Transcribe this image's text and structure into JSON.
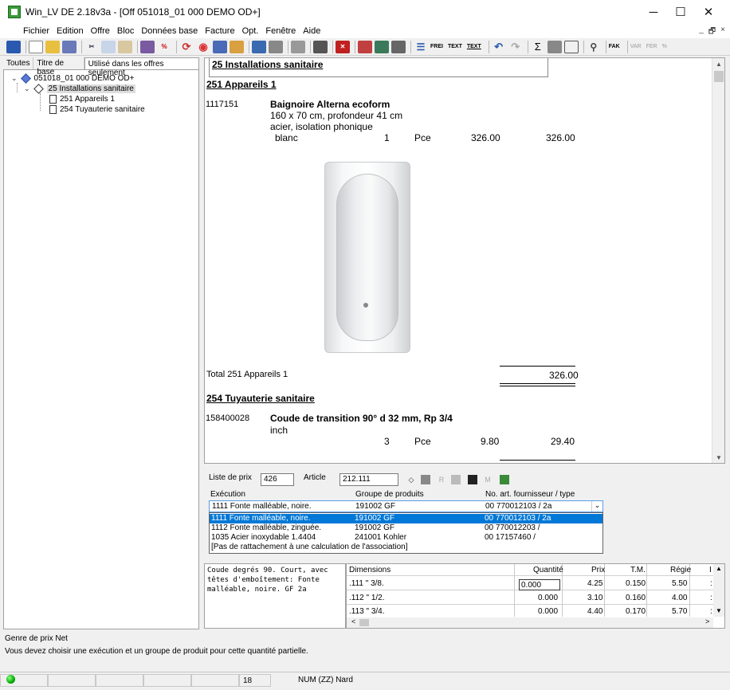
{
  "window": {
    "title": "Win_LV DE 2.18v3a - [Off 051018_01 000 DEMO OD+]",
    "controls": {
      "minimize": "─",
      "maximize": "☐",
      "close": "✕"
    }
  },
  "menu": [
    "Fichier",
    "Edition",
    "Offre",
    "Bloc",
    "Données base",
    "Facture",
    "Opt.",
    "Fenêtre",
    "Aide"
  ],
  "mdi_controls": {
    "minimize": "_",
    "restore": "🗗",
    "close": "×"
  },
  "toolbar": {
    "text_buttons": [
      "FREI",
      "TEXT",
      "TEXT"
    ],
    "fak": "FAK",
    "dim_buttons": [
      "VAR",
      "FER",
      "%"
    ]
  },
  "left": {
    "tabs": [
      "Toutes",
      "Titre de base",
      "Utilisé dans les offres seulement"
    ],
    "tree": {
      "root": "051018_01 000 DEMO OD+",
      "child": "25 Installations sanitaire",
      "leaves": [
        "251 Appareils 1",
        "254 Tuyauterie sanitaire"
      ]
    }
  },
  "document": {
    "heading": "25 Installations sanitaire",
    "section1": "251 Appareils 1",
    "item1": {
      "number": "1117151",
      "name": "Baignoire Alterna ecoform",
      "line1": "160 x 70 cm, profondeur 41 cm",
      "line2": "acier, isolation phonique",
      "color": "blanc",
      "qty": "1",
      "unit": "Pce",
      "price": "326.00",
      "total": "326.00"
    },
    "total_label": "Total  251 Appareils 1",
    "total_value": "326.00",
    "section2": "254 Tuyauterie sanitaire",
    "item2": {
      "number": "158400028",
      "name": "Coude de transition 90° d 32 mm, Rp 3/4",
      "line1": "inch",
      "qty": "3",
      "unit": "Pce",
      "price": "9.80",
      "total": "29.40"
    }
  },
  "form": {
    "price_list_label": "Liste de prix",
    "price_list_value": "426",
    "article_label": "Article",
    "article_value": "212.111",
    "icon_letters": [
      "R",
      "M"
    ],
    "execution_label": "Exécution",
    "group_label": "Groupe de produits",
    "supplier_label": "No. art. fournisseur / type",
    "combo": {
      "execution": "1111 Fonte malléable, noire.",
      "group": "191002 GF",
      "supplier": "00 770012103 / 2a"
    },
    "dropdown": [
      {
        "execution": "1111 Fonte malléable, noire.",
        "group": "191002 GF",
        "supplier": "00 770012103 / 2a"
      },
      {
        "execution": "1112 Fonte malléable, zinguée.",
        "group": "191002 GF",
        "supplier": "00 770012203 /"
      },
      {
        "execution": "1035 Acier inoxydable 1.4404",
        "group": "241001 Kohler",
        "supplier": "00 17157460 /"
      },
      {
        "execution": "[Pas de rattachement à une calculation de l'association]",
        "group": "",
        "supplier": ""
      }
    ]
  },
  "memo": "Coude degrés 90. Court, avec têtes d'emboîtement: Fonte malléable, noire. GF 2a",
  "grid": {
    "headers": [
      "Dimensions",
      "Quantité",
      "Prix",
      "T.M.",
      "Régie",
      "I"
    ],
    "rows": [
      [
        ".111 \" 3/8.",
        "0.000",
        "4.25",
        "0.150",
        "5.50",
        ":"
      ],
      [
        ".112 \" 1/2.",
        "0.000",
        "3.10",
        "0.160",
        "4.00",
        ":"
      ],
      [
        ".113 \" 3/4.",
        "0.000",
        "4.40",
        "0.170",
        "5.70",
        ":"
      ]
    ]
  },
  "status": {
    "line1": "Genre de prix Net",
    "line2": "Vous devez choisir une exécution et un groupe de produit pour cette quantité partielle.",
    "page": "18",
    "keys": "NUM  (ZZ) Nard"
  }
}
